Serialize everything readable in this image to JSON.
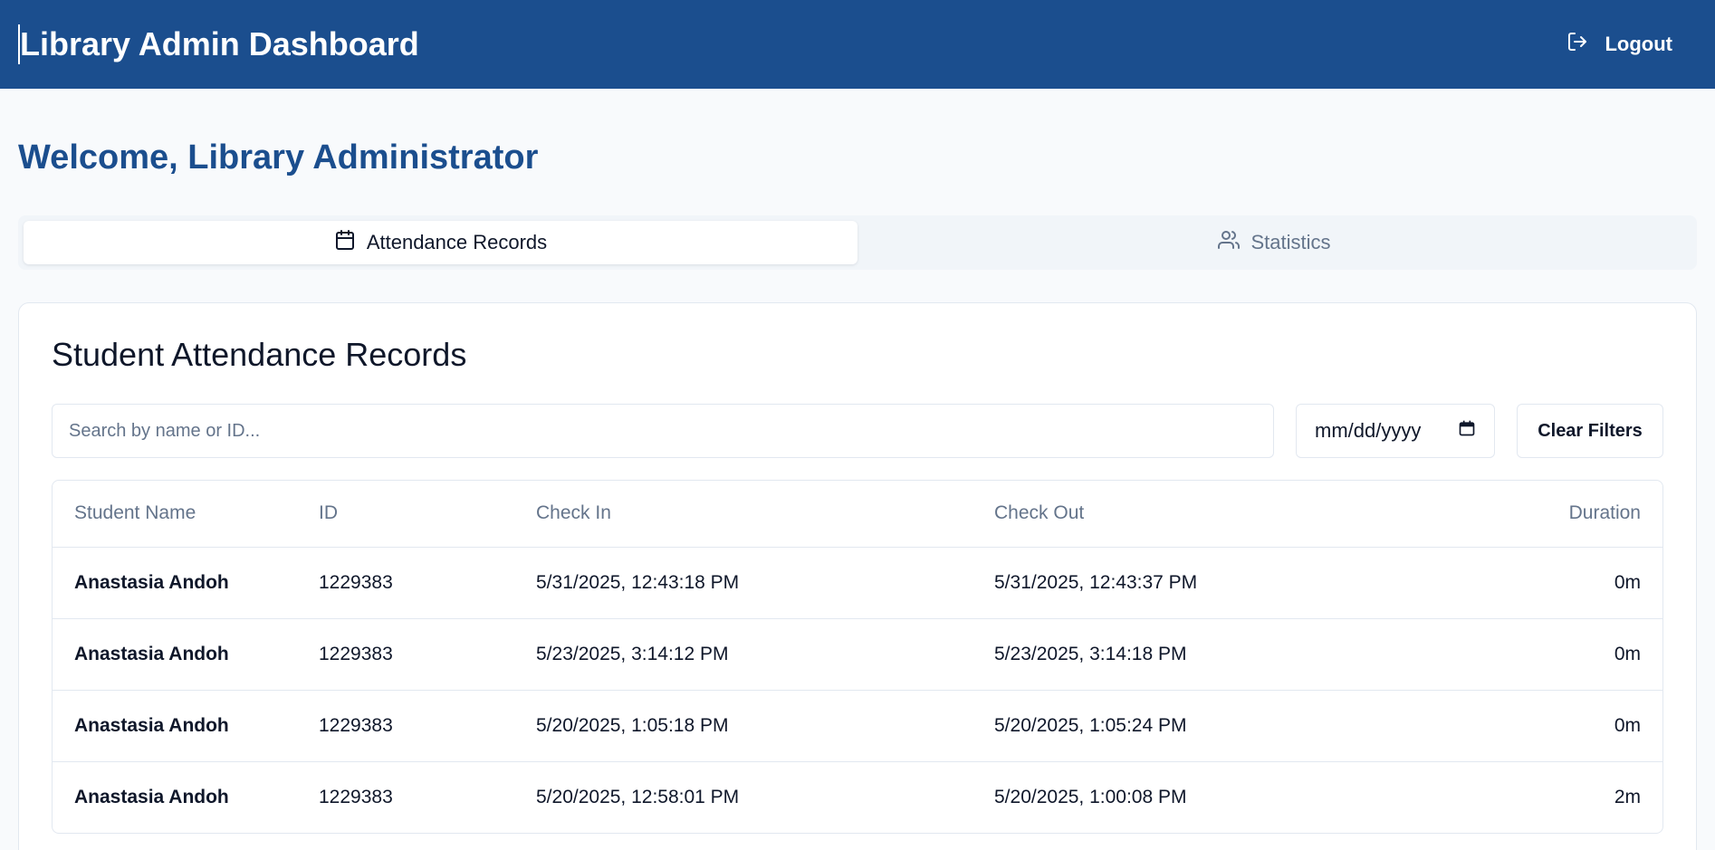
{
  "header": {
    "title": "Library Admin Dashboard",
    "logout_label": "Logout"
  },
  "welcome": "Welcome, Library Administrator",
  "tabs": [
    {
      "label": "Attendance Records",
      "icon": "calendar-icon",
      "active": true
    },
    {
      "label": "Statistics",
      "icon": "users-icon",
      "active": false
    }
  ],
  "records": {
    "title": "Student Attendance Records",
    "search_placeholder": "Search by name or ID...",
    "date_placeholder": "mm/dd/yyyy",
    "clear_label": "Clear Filters",
    "columns": [
      "Student Name",
      "ID",
      "Check In",
      "Check Out",
      "Duration"
    ],
    "rows": [
      {
        "name": "Anastasia Andoh",
        "id": "1229383",
        "check_in": "5/31/2025, 12:43:18 PM",
        "check_out": "5/31/2025, 12:43:37 PM",
        "duration": "0m"
      },
      {
        "name": "Anastasia Andoh",
        "id": "1229383",
        "check_in": "5/23/2025, 3:14:12 PM",
        "check_out": "5/23/2025, 3:14:18 PM",
        "duration": "0m"
      },
      {
        "name": "Anastasia Andoh",
        "id": "1229383",
        "check_in": "5/20/2025, 1:05:18 PM",
        "check_out": "5/20/2025, 1:05:24 PM",
        "duration": "0m"
      },
      {
        "name": "Anastasia Andoh",
        "id": "1229383",
        "check_in": "5/20/2025, 12:58:01 PM",
        "check_out": "5/20/2025, 1:00:08 PM",
        "duration": "2m"
      }
    ]
  },
  "colors": {
    "brand": "#1b4e8e",
    "background": "#f8fafc",
    "muted_text": "#64748b",
    "border": "#e2e8f0"
  }
}
